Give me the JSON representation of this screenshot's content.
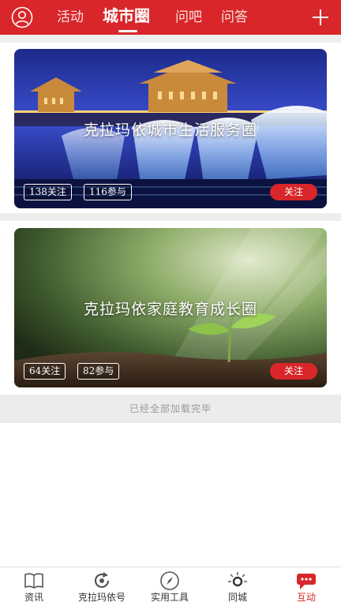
{
  "header": {
    "tabs": [
      {
        "label": "活动",
        "active": false
      },
      {
        "label": "城市圈",
        "active": true
      },
      {
        "label": "问吧",
        "active": false
      },
      {
        "label": "问答",
        "active": false
      }
    ],
    "avatar_icon": "user-circle-icon",
    "add_icon": "plus-icon"
  },
  "circles": [
    {
      "title": "克拉玛依城市生活服务圈",
      "followers": "138关注",
      "participants": "116参与",
      "follow_label": "关注"
    },
    {
      "title": "克拉玛依家庭教育成长圈",
      "followers": "64关注",
      "participants": "82参与",
      "follow_label": "关注"
    }
  ],
  "end_message": "已经全部加载完毕",
  "bottom_nav": [
    {
      "label": "资讯",
      "icon": "book-icon",
      "active": false
    },
    {
      "label": "克拉玛依号",
      "icon": "refresh-icon",
      "active": false
    },
    {
      "label": "实用工具",
      "icon": "compass-icon",
      "active": false
    },
    {
      "label": "同城",
      "icon": "location-icon",
      "active": false
    },
    {
      "label": "互动",
      "icon": "chat-icon",
      "active": true
    }
  ],
  "colors": {
    "brand_red": "#d8262a",
    "end_text": "#999999"
  }
}
